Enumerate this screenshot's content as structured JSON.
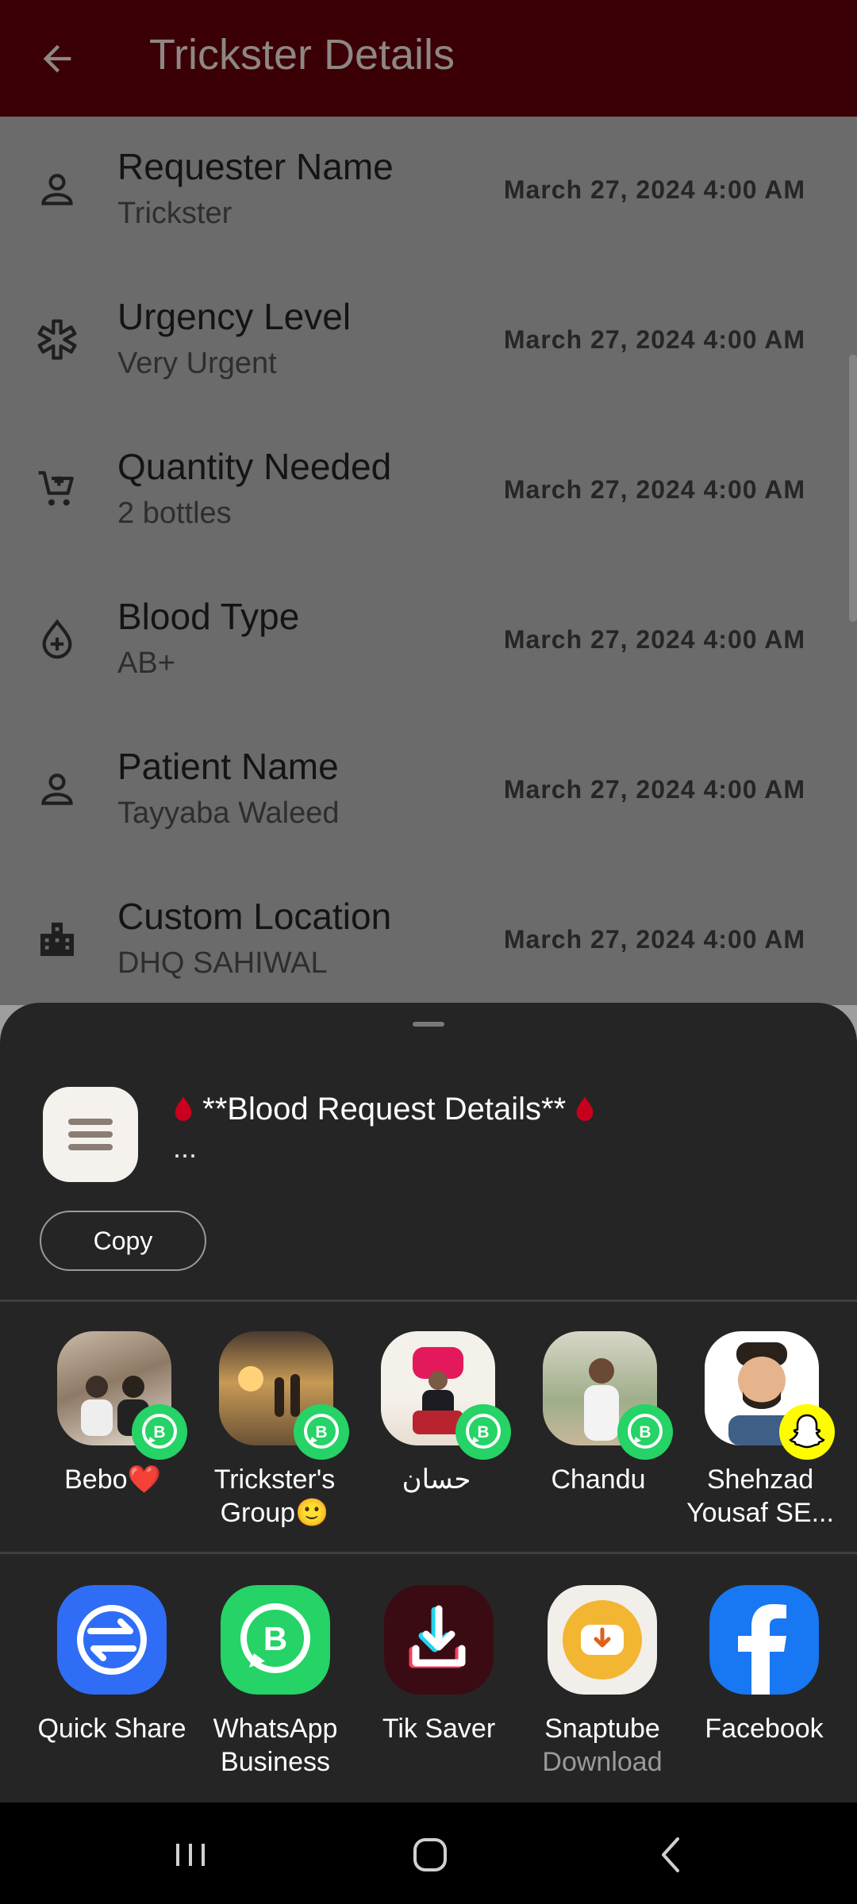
{
  "app_bar": {
    "title": "Trickster Details"
  },
  "details": [
    {
      "icon": "person-icon",
      "label": "Requester Name",
      "value": "Trickster",
      "date": "March 27, 2024 4:00 AM"
    },
    {
      "icon": "medical-icon",
      "label": "Urgency Level",
      "value": "Very Urgent",
      "date": "March 27, 2024 4:00 AM"
    },
    {
      "icon": "cart-icon",
      "label": "Quantity Needed",
      "value": "2 bottles",
      "date": "March 27, 2024 4:00 AM"
    },
    {
      "icon": "blood-drop-icon",
      "label": "Blood Type",
      "value": "AB+",
      "date": "March 27, 2024 4:00 AM"
    },
    {
      "icon": "person-icon",
      "label": "Patient Name",
      "value": "Tayyaba Waleed",
      "date": "March 27, 2024 4:00 AM"
    },
    {
      "icon": "building-icon",
      "label": "Custom Location",
      "value": "DHQ SAHIWAL",
      "date": "March 27, 2024 4:00 AM"
    }
  ],
  "share_sheet": {
    "preview_text": "**Blood Request Details**",
    "preview_more": "...",
    "copy_label": "Copy",
    "contacts": [
      {
        "name": "Bebo❤️",
        "badge": "whatsapp-business-badge-icon"
      },
      {
        "name": "Trickster's Group🙂",
        "badge": "whatsapp-business-badge-icon"
      },
      {
        "name": "حسان",
        "badge": "whatsapp-business-badge-icon"
      },
      {
        "name": "Chandu",
        "badge": "whatsapp-business-badge-icon"
      },
      {
        "name": "Shehzad Yousaf SE...",
        "badge": "snapchat-badge-icon"
      }
    ],
    "apps": [
      {
        "name": "Quick Share",
        "sub": ""
      },
      {
        "name": "WhatsApp Business",
        "sub": ""
      },
      {
        "name": "Tik Saver",
        "sub": ""
      },
      {
        "name": "Snaptube",
        "sub": "Download"
      },
      {
        "name": "Facebook",
        "sub": ""
      }
    ]
  },
  "colors": {
    "app_bar": "#3a0006",
    "sheet_bg": "#252525",
    "whatsapp_green": "#25d366",
    "quick_share_blue": "#2f6df6",
    "facebook_blue": "#1877f2",
    "snapchat_yellow": "#fffc00",
    "blood_red": "#c8001e"
  }
}
